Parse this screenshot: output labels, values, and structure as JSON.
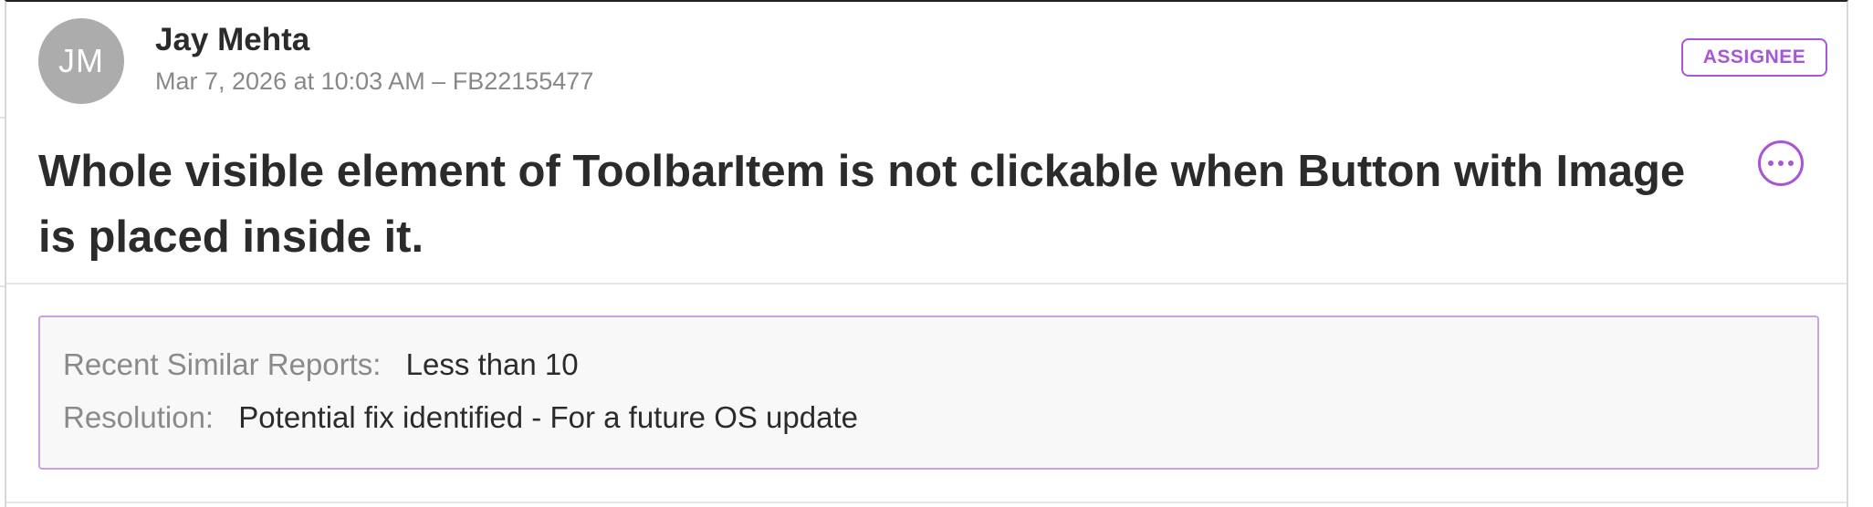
{
  "author": {
    "initials": "JM",
    "name": "Jay Mehta",
    "meta": "Mar 7, 2026 at 10:03 AM – FB22155477"
  },
  "badge": {
    "label": "ASSIGNEE"
  },
  "issue": {
    "title": "Whole visible element of ToolbarItem is not clickable when Button with Image is placed inside it."
  },
  "details": [
    {
      "label": "Recent Similar Reports:",
      "value": "Less than 10"
    },
    {
      "label": "Resolution:",
      "value": "Potential fix identified - For a future OS update"
    }
  ],
  "colors": {
    "accent": "#a855d6",
    "avatar_bg": "#acacac",
    "info_bg": "#f8f8f8"
  },
  "icons": {
    "more": "ellipsis-circle-icon"
  }
}
